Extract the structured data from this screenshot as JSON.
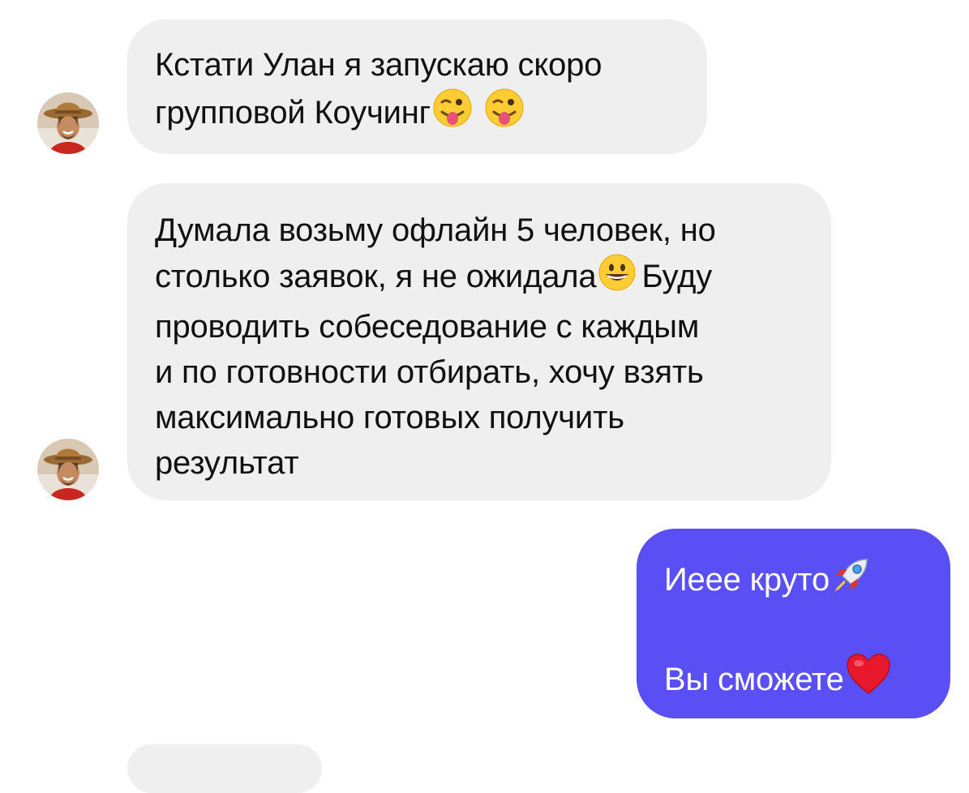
{
  "conversation": {
    "messages": [
      {
        "direction": "incoming",
        "lines": [
          {
            "text": "Кстати Улан я запускаю скоро",
            "emojis": []
          },
          {
            "text": "групповой Коучинг",
            "emojis": [
              "winking-face-with-tongue",
              "winking-face-with-tongue"
            ]
          }
        ]
      },
      {
        "direction": "incoming",
        "lines": [
          {
            "text": "Думала возьму офлайн 5 человек, но",
            "emojis": []
          },
          {
            "text": "столько заявок, я не ожидала",
            "emojis": [
              "grinning-face"
            ],
            "after": "Буду"
          },
          {
            "text": "проводить собеседование с каждым",
            "emojis": []
          },
          {
            "text": "и по готовности отбирать, хочу взять",
            "emojis": []
          },
          {
            "text": "максимально готовых получить",
            "emojis": []
          },
          {
            "text": "результат",
            "emojis": []
          }
        ]
      },
      {
        "direction": "outgoing",
        "lines": [
          {
            "text": "Иеее круто",
            "emojis": [
              "rocket"
            ]
          },
          {
            "text": "",
            "emojis": []
          },
          {
            "text": "Вы сможете",
            "emojis": [
              "red-heart"
            ]
          }
        ]
      }
    ],
    "avatar_icon": "contact-avatar-woman-in-hat",
    "colors": {
      "incoming_bubble": "#efefef",
      "outgoing_bubble": "#5a4ff5",
      "incoming_text": "#111111",
      "outgoing_text": "#ffffff"
    }
  }
}
